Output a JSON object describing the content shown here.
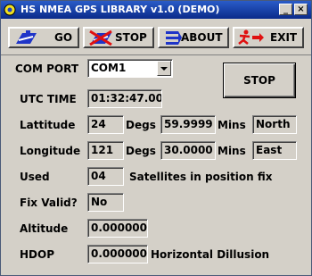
{
  "window": {
    "title": "HS NMEA GPS LIBRARY v1.0 (DEMO)",
    "controls": {
      "minimize": "_",
      "close": "×"
    }
  },
  "toolbar": {
    "go": "GO",
    "stop": "STOP",
    "about": "ABOUT",
    "exit": "EXIT"
  },
  "form": {
    "com_port_label": "COM PORT",
    "com_port_value": "COM1",
    "stop_button": "STOP",
    "utc_label": "UTC TIME",
    "utc_value": "01:32:47.00",
    "lat_label": "Lattitude",
    "lat_deg": "24",
    "lat_degs_label": "Degs",
    "lat_min": "59.9999",
    "lat_mins_label": "Mins",
    "lat_dir": "North",
    "lon_label": "Longitude",
    "lon_deg": "121",
    "lon_degs_label": "Degs",
    "lon_min": "30.0000",
    "lon_mins_label": "Mins",
    "lon_dir": "East",
    "used_label": "Used",
    "used_value": "04",
    "used_desc": "Satellites in position fix",
    "fix_label": "Fix Valid?",
    "fix_value": "No",
    "alt_label": "Altitude",
    "alt_value": "0.000000",
    "hdop_label": "HDOP",
    "hdop_value": "0.000000",
    "hdop_desc": "Horizontal Dillusion"
  },
  "colors": {
    "titlebar": "#0a2a8a",
    "face": "#d4d0c8",
    "icon_blue": "#1f35c8",
    "icon_red": "#e01010"
  }
}
